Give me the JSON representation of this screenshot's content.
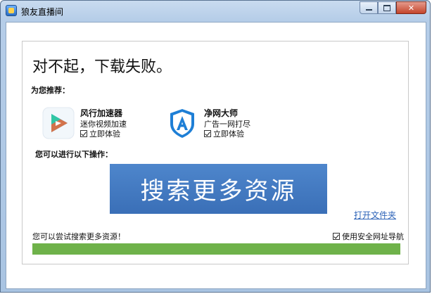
{
  "window": {
    "title": "狼友直播间",
    "controls": {
      "minimize_icon": "minimize-icon",
      "maximize_icon": "maximize-icon",
      "close_symbol": "✕"
    }
  },
  "main": {
    "headline": "对不起，下载失败。",
    "recommend_label": "为您推荐：",
    "recommendations": [
      {
        "name": "风行加速器",
        "desc": "迷你视频加速",
        "try_label": "立即体验",
        "checked": true,
        "icon": "play-logo-icon"
      },
      {
        "name": "净网大师",
        "desc": "广告一网打尽",
        "try_label": "立即体验",
        "checked": true,
        "icon": "shield-logo-icon"
      }
    ],
    "ops_label": "您可以进行以下操作：",
    "search_button": "搜索更多资源",
    "open_folder": "打开文件夹",
    "hint": "您可以尝试搜索更多资源！",
    "nav_toggle": {
      "label": "使用安全网址导航",
      "checked": true
    },
    "progress": {
      "fraction": 1.0,
      "color": "#6fb24a"
    }
  },
  "colors": {
    "accent": "#3f75bd",
    "link": "#2d63b8",
    "progress": "#6fb24a"
  }
}
